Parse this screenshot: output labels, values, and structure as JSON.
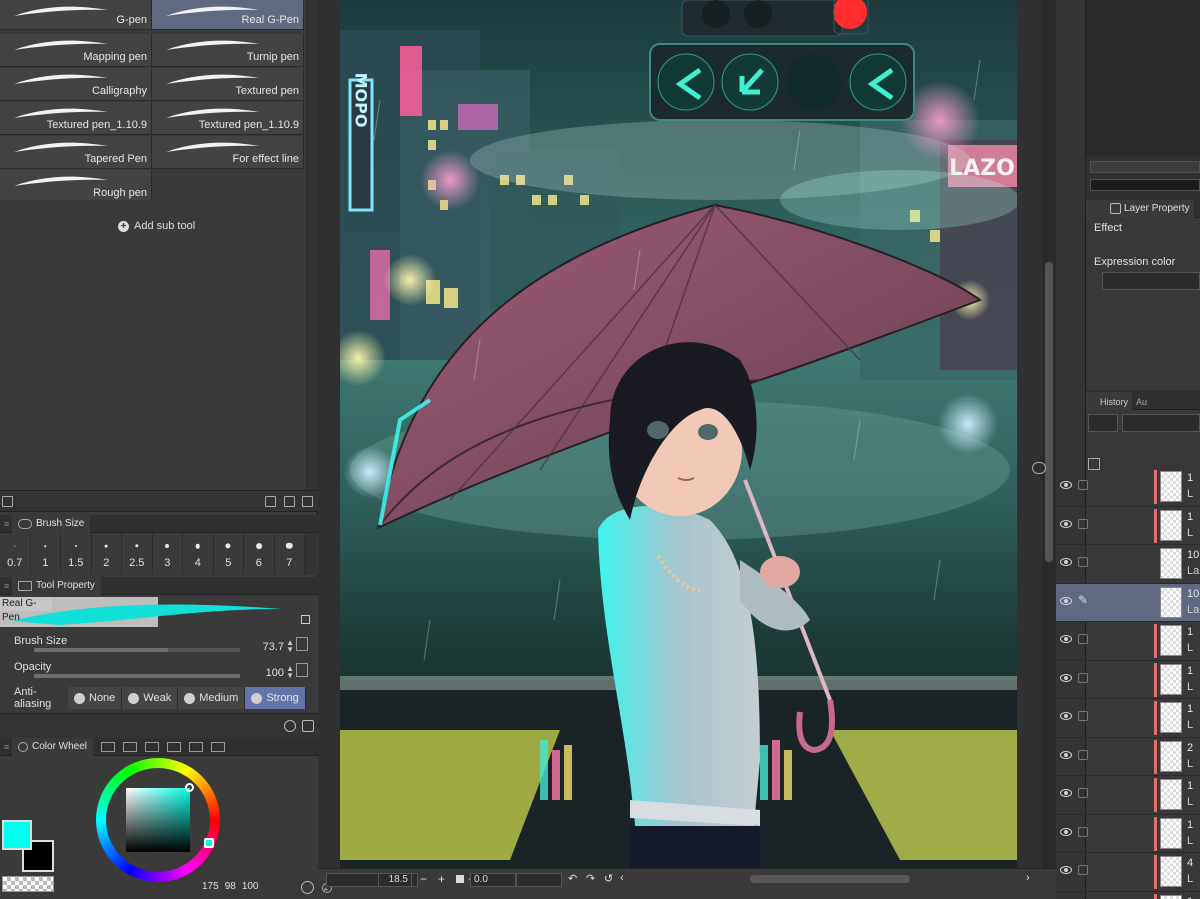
{
  "sub_tool": {
    "brushes": [
      {
        "label": "G-pen",
        "selected": false
      },
      {
        "label": "Real G-Pen",
        "selected": true
      },
      {
        "label": "Mapping pen",
        "selected": false
      },
      {
        "label": "Turnip pen",
        "selected": false
      },
      {
        "label": "Calligraphy",
        "selected": false
      },
      {
        "label": "Textured pen",
        "selected": false
      },
      {
        "label": "Textured pen_1.10.9",
        "selected": false
      },
      {
        "label": "Textured pen_1.10.9",
        "selected": false
      },
      {
        "label": "Tapered Pen",
        "selected": false
      },
      {
        "label": "For effect line",
        "selected": false
      },
      {
        "label": "Rough pen",
        "selected": false
      }
    ],
    "add_sub_tool_label": "Add sub tool"
  },
  "brush_size": {
    "tab_label": "Brush Size",
    "sizes": [
      "0.7",
      "1",
      "1.5",
      "2",
      "2.5",
      "3",
      "4",
      "5",
      "6",
      "7"
    ]
  },
  "tool_property": {
    "tab_label": "Tool Property",
    "tool_name": "Real G-Pen",
    "brush_size_label": "Brush Size",
    "brush_size_value": "73.7",
    "brush_size_fraction": 0.65,
    "opacity_label": "Opacity",
    "opacity_value": "100",
    "opacity_fraction": 1.0,
    "anti_aliasing_label": "Anti-aliasing",
    "anti_aliasing_options": [
      "None",
      "Weak",
      "Medium",
      "Strong"
    ],
    "anti_aliasing_selected": "Strong"
  },
  "color_wheel": {
    "tab_label": "Color Wheel",
    "main_color": "#00ffee",
    "sub_color": "#000000",
    "values": [
      "175",
      "98",
      "100"
    ]
  },
  "canvas": {
    "zoom": "18.5",
    "rotation": "0.0"
  },
  "layer_property": {
    "tab_label": "Layer Property",
    "effect_label": "Effect",
    "expression_color_label": "Expression color"
  },
  "layer_panel": {
    "history_tab": "History",
    "auto_tab": "Au",
    "layers": [
      {
        "name": "1",
        "sub": "L",
        "red": true,
        "selected": false,
        "pen": false
      },
      {
        "name": "1",
        "sub": "L",
        "red": true,
        "selected": false,
        "pen": false
      },
      {
        "name": "10",
        "sub": "La",
        "red": false,
        "selected": false,
        "pen": false
      },
      {
        "name": "10",
        "sub": "La",
        "red": false,
        "selected": true,
        "pen": true
      },
      {
        "name": "1",
        "sub": "L",
        "red": true,
        "selected": false,
        "pen": false
      },
      {
        "name": "1",
        "sub": "L",
        "red": true,
        "selected": false,
        "pen": false
      },
      {
        "name": "1",
        "sub": "L",
        "red": true,
        "selected": false,
        "pen": false
      },
      {
        "name": "2",
        "sub": "L",
        "red": true,
        "selected": false,
        "pen": false
      },
      {
        "name": "1",
        "sub": "L",
        "red": true,
        "selected": false,
        "pen": false
      },
      {
        "name": "1",
        "sub": "L",
        "red": true,
        "selected": false,
        "pen": false
      },
      {
        "name": "4",
        "sub": "L",
        "red": true,
        "selected": false,
        "pen": false
      },
      {
        "name": "1",
        "sub": "L",
        "red": true,
        "selected": false,
        "pen": false
      }
    ]
  },
  "artwork": {
    "signs": [
      "MOPO",
      "LAZO"
    ],
    "light_colors": [
      "#ffe98a",
      "#ff6fb1",
      "#7fd4ff",
      "#f7e36b"
    ]
  }
}
